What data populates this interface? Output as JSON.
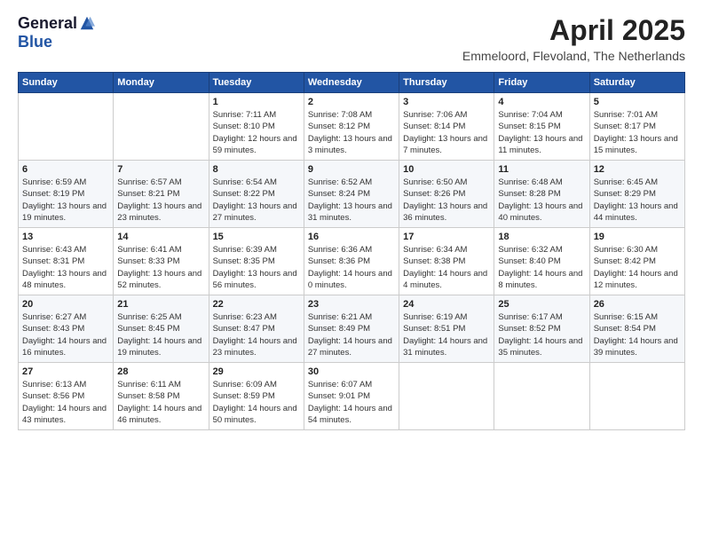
{
  "header": {
    "logo_general": "General",
    "logo_blue": "Blue",
    "month_year": "April 2025",
    "location": "Emmeloord, Flevoland, The Netherlands"
  },
  "days_of_week": [
    "Sunday",
    "Monday",
    "Tuesday",
    "Wednesday",
    "Thursday",
    "Friday",
    "Saturday"
  ],
  "weeks": [
    [
      {
        "day": "",
        "sunrise": "",
        "sunset": "",
        "daylight": ""
      },
      {
        "day": "",
        "sunrise": "",
        "sunset": "",
        "daylight": ""
      },
      {
        "day": "1",
        "sunrise": "Sunrise: 7:11 AM",
        "sunset": "Sunset: 8:10 PM",
        "daylight": "Daylight: 12 hours and 59 minutes."
      },
      {
        "day": "2",
        "sunrise": "Sunrise: 7:08 AM",
        "sunset": "Sunset: 8:12 PM",
        "daylight": "Daylight: 13 hours and 3 minutes."
      },
      {
        "day": "3",
        "sunrise": "Sunrise: 7:06 AM",
        "sunset": "Sunset: 8:14 PM",
        "daylight": "Daylight: 13 hours and 7 minutes."
      },
      {
        "day": "4",
        "sunrise": "Sunrise: 7:04 AM",
        "sunset": "Sunset: 8:15 PM",
        "daylight": "Daylight: 13 hours and 11 minutes."
      },
      {
        "day": "5",
        "sunrise": "Sunrise: 7:01 AM",
        "sunset": "Sunset: 8:17 PM",
        "daylight": "Daylight: 13 hours and 15 minutes."
      }
    ],
    [
      {
        "day": "6",
        "sunrise": "Sunrise: 6:59 AM",
        "sunset": "Sunset: 8:19 PM",
        "daylight": "Daylight: 13 hours and 19 minutes."
      },
      {
        "day": "7",
        "sunrise": "Sunrise: 6:57 AM",
        "sunset": "Sunset: 8:21 PM",
        "daylight": "Daylight: 13 hours and 23 minutes."
      },
      {
        "day": "8",
        "sunrise": "Sunrise: 6:54 AM",
        "sunset": "Sunset: 8:22 PM",
        "daylight": "Daylight: 13 hours and 27 minutes."
      },
      {
        "day": "9",
        "sunrise": "Sunrise: 6:52 AM",
        "sunset": "Sunset: 8:24 PM",
        "daylight": "Daylight: 13 hours and 31 minutes."
      },
      {
        "day": "10",
        "sunrise": "Sunrise: 6:50 AM",
        "sunset": "Sunset: 8:26 PM",
        "daylight": "Daylight: 13 hours and 36 minutes."
      },
      {
        "day": "11",
        "sunrise": "Sunrise: 6:48 AM",
        "sunset": "Sunset: 8:28 PM",
        "daylight": "Daylight: 13 hours and 40 minutes."
      },
      {
        "day": "12",
        "sunrise": "Sunrise: 6:45 AM",
        "sunset": "Sunset: 8:29 PM",
        "daylight": "Daylight: 13 hours and 44 minutes."
      }
    ],
    [
      {
        "day": "13",
        "sunrise": "Sunrise: 6:43 AM",
        "sunset": "Sunset: 8:31 PM",
        "daylight": "Daylight: 13 hours and 48 minutes."
      },
      {
        "day": "14",
        "sunrise": "Sunrise: 6:41 AM",
        "sunset": "Sunset: 8:33 PM",
        "daylight": "Daylight: 13 hours and 52 minutes."
      },
      {
        "day": "15",
        "sunrise": "Sunrise: 6:39 AM",
        "sunset": "Sunset: 8:35 PM",
        "daylight": "Daylight: 13 hours and 56 minutes."
      },
      {
        "day": "16",
        "sunrise": "Sunrise: 6:36 AM",
        "sunset": "Sunset: 8:36 PM",
        "daylight": "Daylight: 14 hours and 0 minutes."
      },
      {
        "day": "17",
        "sunrise": "Sunrise: 6:34 AM",
        "sunset": "Sunset: 8:38 PM",
        "daylight": "Daylight: 14 hours and 4 minutes."
      },
      {
        "day": "18",
        "sunrise": "Sunrise: 6:32 AM",
        "sunset": "Sunset: 8:40 PM",
        "daylight": "Daylight: 14 hours and 8 minutes."
      },
      {
        "day": "19",
        "sunrise": "Sunrise: 6:30 AM",
        "sunset": "Sunset: 8:42 PM",
        "daylight": "Daylight: 14 hours and 12 minutes."
      }
    ],
    [
      {
        "day": "20",
        "sunrise": "Sunrise: 6:27 AM",
        "sunset": "Sunset: 8:43 PM",
        "daylight": "Daylight: 14 hours and 16 minutes."
      },
      {
        "day": "21",
        "sunrise": "Sunrise: 6:25 AM",
        "sunset": "Sunset: 8:45 PM",
        "daylight": "Daylight: 14 hours and 19 minutes."
      },
      {
        "day": "22",
        "sunrise": "Sunrise: 6:23 AM",
        "sunset": "Sunset: 8:47 PM",
        "daylight": "Daylight: 14 hours and 23 minutes."
      },
      {
        "day": "23",
        "sunrise": "Sunrise: 6:21 AM",
        "sunset": "Sunset: 8:49 PM",
        "daylight": "Daylight: 14 hours and 27 minutes."
      },
      {
        "day": "24",
        "sunrise": "Sunrise: 6:19 AM",
        "sunset": "Sunset: 8:51 PM",
        "daylight": "Daylight: 14 hours and 31 minutes."
      },
      {
        "day": "25",
        "sunrise": "Sunrise: 6:17 AM",
        "sunset": "Sunset: 8:52 PM",
        "daylight": "Daylight: 14 hours and 35 minutes."
      },
      {
        "day": "26",
        "sunrise": "Sunrise: 6:15 AM",
        "sunset": "Sunset: 8:54 PM",
        "daylight": "Daylight: 14 hours and 39 minutes."
      }
    ],
    [
      {
        "day": "27",
        "sunrise": "Sunrise: 6:13 AM",
        "sunset": "Sunset: 8:56 PM",
        "daylight": "Daylight: 14 hours and 43 minutes."
      },
      {
        "day": "28",
        "sunrise": "Sunrise: 6:11 AM",
        "sunset": "Sunset: 8:58 PM",
        "daylight": "Daylight: 14 hours and 46 minutes."
      },
      {
        "day": "29",
        "sunrise": "Sunrise: 6:09 AM",
        "sunset": "Sunset: 8:59 PM",
        "daylight": "Daylight: 14 hours and 50 minutes."
      },
      {
        "day": "30",
        "sunrise": "Sunrise: 6:07 AM",
        "sunset": "Sunset: 9:01 PM",
        "daylight": "Daylight: 14 hours and 54 minutes."
      },
      {
        "day": "",
        "sunrise": "",
        "sunset": "",
        "daylight": ""
      },
      {
        "day": "",
        "sunrise": "",
        "sunset": "",
        "daylight": ""
      },
      {
        "day": "",
        "sunrise": "",
        "sunset": "",
        "daylight": ""
      }
    ]
  ]
}
